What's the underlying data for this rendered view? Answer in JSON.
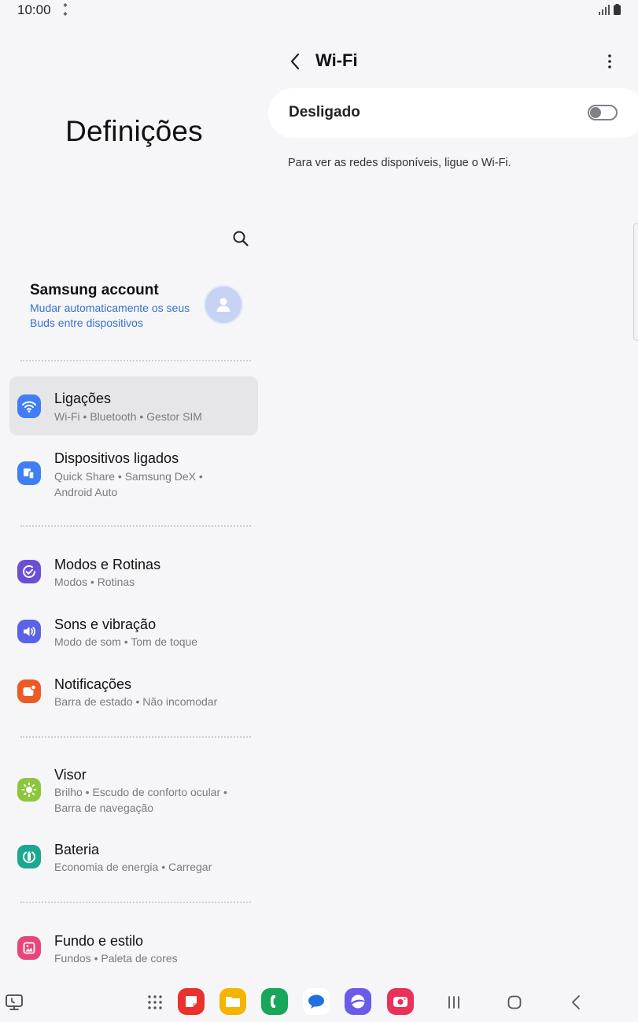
{
  "status_bar": {
    "time": "10:00",
    "icons": [
      "sync-icon",
      "signal-icon",
      "battery-icon"
    ]
  },
  "left_pane": {
    "title": "Definições",
    "account": {
      "title": "Samsung account",
      "subtitle": "Mudar automaticamente os seus Buds entre dispositivos"
    },
    "items": [
      {
        "title": "Ligações",
        "subtitle": "Wi-Fi  •  Bluetooth  •  Gestor SIM",
        "icon": "wifi-icon",
        "color": "#3f7ef5",
        "selected": true
      },
      {
        "title": "Dispositivos ligados",
        "subtitle": "Quick Share  •  Samsung DeX  •  Android Auto",
        "icon": "devices-icon",
        "color": "#3f7ef5"
      },
      {
        "title": "Modos e Rotinas",
        "subtitle": "Modos  •  Rotinas",
        "icon": "modes-icon",
        "color": "#6a4fd6"
      },
      {
        "title": "Sons e vibração",
        "subtitle": "Modo de som  •  Tom de toque",
        "icon": "sound-icon",
        "color": "#5a63e6"
      },
      {
        "title": "Notificações",
        "subtitle": "Barra de estado  •  Não incomodar",
        "icon": "notification-icon",
        "color": "#ee5a24"
      },
      {
        "title": "Visor",
        "subtitle": "Brilho  •  Escudo de conforto ocular  •  Barra de navegação",
        "icon": "brightness-icon",
        "color": "#8cc63f"
      },
      {
        "title": "Bateria",
        "subtitle": "Economia de energia  •  Carregar",
        "icon": "battery-care-icon",
        "color": "#1aa88f"
      },
      {
        "title": "Fundo e estilo",
        "subtitle": "Fundos  •  Paleta de cores",
        "icon": "wallpaper-icon",
        "color": "#e8467a"
      }
    ]
  },
  "right_pane": {
    "title": "Wi-Fi",
    "toggle_label": "Desligado",
    "toggle_on": false,
    "info_text": "Para ver as redes disponíveis, ligue o Wi-Fi."
  },
  "taskbar": {
    "apps": [
      {
        "name": "notes-app-icon",
        "color": "#e8322b"
      },
      {
        "name": "files-app-icon",
        "color": "#f5b400"
      },
      {
        "name": "phone-app-icon",
        "color": "#19a55a"
      },
      {
        "name": "messages-app-icon",
        "color": "#1f6fe0"
      },
      {
        "name": "internet-app-icon",
        "color": "#6a5be8"
      },
      {
        "name": "camera-app-icon",
        "color": "#e8325a"
      }
    ]
  }
}
